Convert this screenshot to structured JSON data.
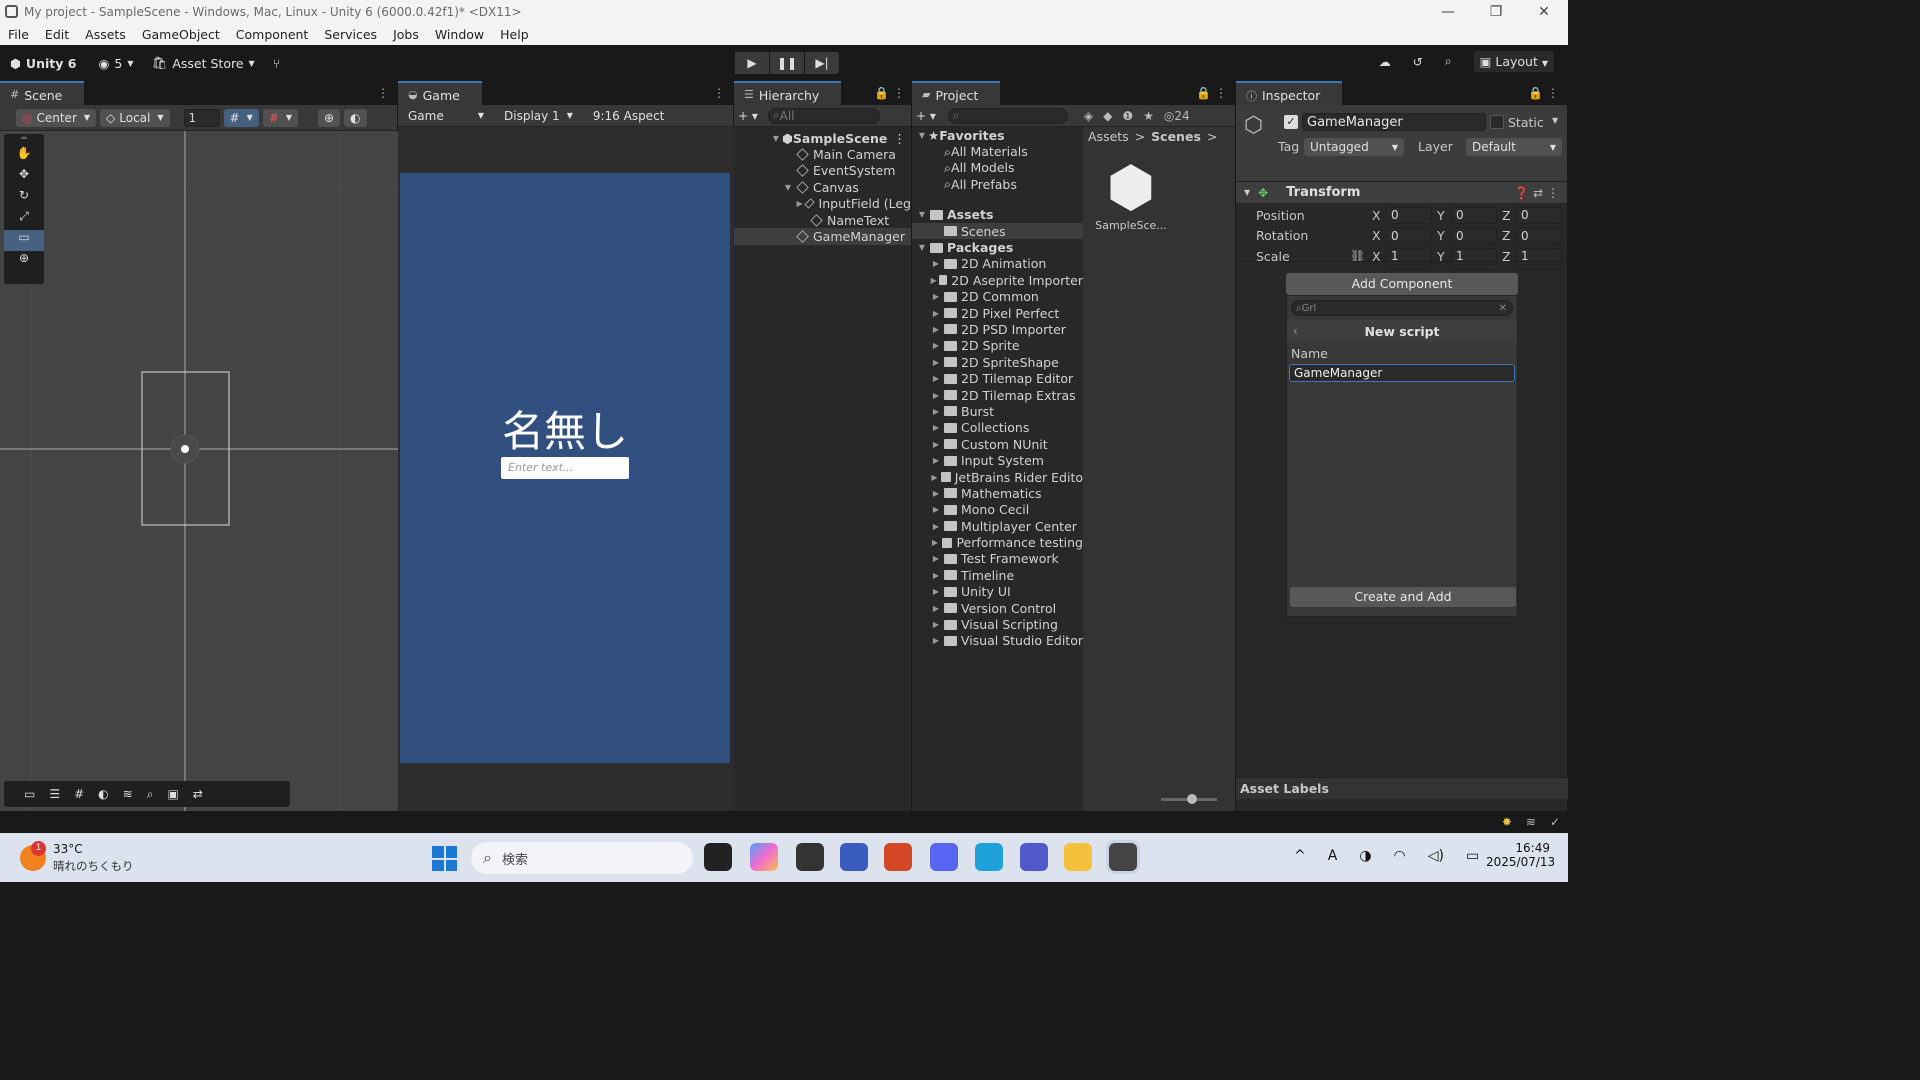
{
  "window": {
    "title": "My project - SampleScene - Windows, Mac, Linux - Unity 6 (6000.0.42f1)* <DX11>",
    "min": "—",
    "max": "❐",
    "close": "✕"
  },
  "menu": [
    "File",
    "Edit",
    "Assets",
    "GameObject",
    "Component",
    "Services",
    "Jobs",
    "Window",
    "Help"
  ],
  "toolbar": {
    "unity_label": "Unity 6",
    "account_badge": "5",
    "asset_store": "Asset Store",
    "layout": "Layout"
  },
  "scene": {
    "tab": "Scene",
    "pivot": "Center",
    "space": "Local",
    "grid_value": "1"
  },
  "game": {
    "tab": "Game",
    "mode": "Game",
    "display": "Display 1",
    "aspect": "9:16 Aspect",
    "title_text": "名無し",
    "input_placeholder": "Enter text..."
  },
  "hierarchy": {
    "tab": "Hierarchy",
    "search_placeholder": "All",
    "scene_name": "SampleScene",
    "items": [
      "Main Camera",
      "EventSystem",
      "Canvas",
      "InputField (Leg",
      "NameText",
      "GameManager"
    ]
  },
  "project": {
    "tab": "Project",
    "visible_count": "24",
    "favorites_label": "Favorites",
    "favorites": [
      "All Materials",
      "All Models",
      "All Prefabs"
    ],
    "assets_label": "Assets",
    "assets_children": [
      "Scenes"
    ],
    "packages_label": "Packages",
    "packages": [
      "2D Animation",
      "2D Aseprite Importer",
      "2D Common",
      "2D Pixel Perfect",
      "2D PSD Importer",
      "2D Sprite",
      "2D SpriteShape",
      "2D Tilemap Editor",
      "2D Tilemap Extras",
      "Burst",
      "Collections",
      "Custom NUnit",
      "Input System",
      "JetBrains Rider Edito",
      "Mathematics",
      "Mono Cecil",
      "Multiplayer Center",
      "Performance testing",
      "Test Framework",
      "Timeline",
      "Unity UI",
      "Version Control",
      "Visual Scripting",
      "Visual Studio Editor"
    ],
    "breadcrumb": [
      "Assets",
      "Scenes"
    ],
    "breadcrumb_sep": ">",
    "asset_item": "SampleSce..."
  },
  "inspector": {
    "tab": "Inspector",
    "object_name": "GameManager",
    "static_label": "Static",
    "tag_label": "Tag",
    "tag_value": "Untagged",
    "layer_label": "Layer",
    "layer_value": "Default",
    "transform_label": "Transform",
    "position_label": "Position",
    "rotation_label": "Rotation",
    "scale_label": "Scale",
    "x": "X",
    "y": "Y",
    "z": "Z",
    "position": [
      "0",
      "0",
      "0"
    ],
    "rotation": [
      "0",
      "0",
      "0"
    ],
    "scale": [
      "1",
      "1",
      "1"
    ],
    "add_component": "Add Component",
    "search_value": "Grl",
    "new_script_title": "New script",
    "name_label": "Name",
    "name_value": "GameManager",
    "create_add": "Create and Add",
    "asset_labels": "Asset Labels"
  },
  "taskbar": {
    "weather_temp": "33°C",
    "weather_desc": "晴れのちくもり",
    "weather_badge": "1",
    "search_placeholder": "検索",
    "time": "16:49",
    "date": "2025/07/13"
  },
  "colors": {
    "game_bg": "#31507f",
    "accent": "#3a79bb"
  }
}
